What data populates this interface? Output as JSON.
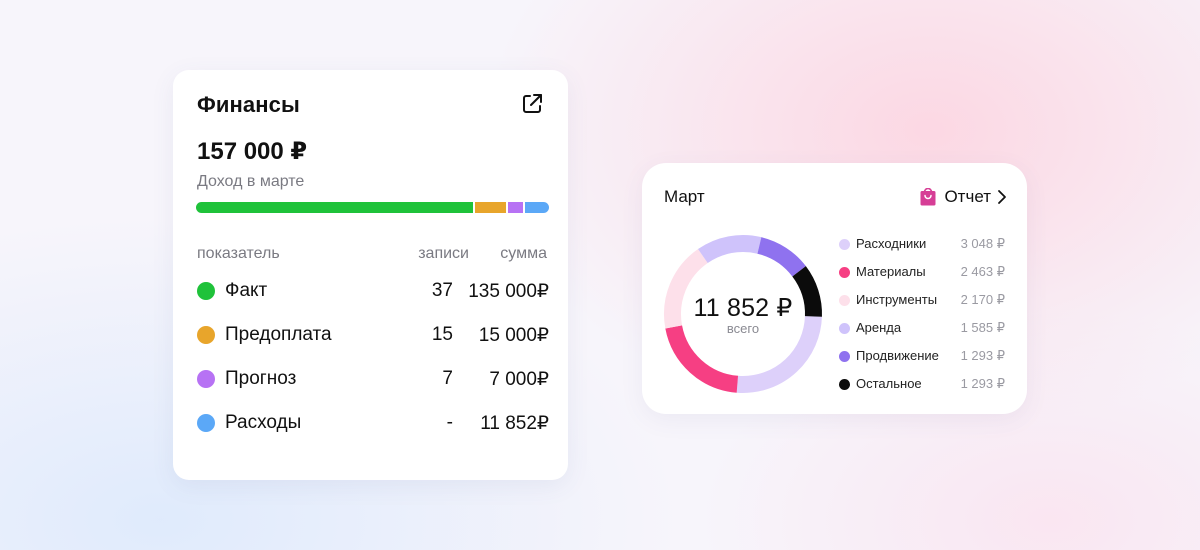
{
  "finance": {
    "title": "Финансы",
    "icons": {
      "external_link": "external-link-icon"
    },
    "amount": "157 000 ₽",
    "subtitle": "Доход в марте",
    "progress": [
      {
        "name": "Факт",
        "value": 135000,
        "color": "#1fc23a"
      },
      {
        "name": "Предоплата",
        "value": 15000,
        "color": "#e8a52b"
      },
      {
        "name": "Прогноз",
        "value": 7000,
        "color": "#b772f4"
      },
      {
        "name": "Расходы",
        "value": 11852,
        "color": "#5ba8f7"
      }
    ],
    "table": {
      "headers": {
        "name": "показатель",
        "records": "записи",
        "sum": "сумма"
      },
      "rows": [
        {
          "name": "Факт",
          "records": "37",
          "sum": "135 000₽",
          "color": "#1fc23a"
        },
        {
          "name": "Предоплата",
          "records": "15",
          "sum": "15 000₽",
          "color": "#e8a52b"
        },
        {
          "name": "Прогноз",
          "records": "7",
          "sum": "7 000₽",
          "color": "#b772f4"
        },
        {
          "name": "Расходы",
          "records": "-",
          "sum": "11 852₽",
          "color": "#5ba8f7"
        }
      ]
    }
  },
  "march": {
    "title": "Март",
    "report": {
      "label": "Отчет",
      "icon": "shopping-bag-icon",
      "chevron": "chevron-right-icon",
      "icon_color": "#d63e96"
    },
    "total": "11 852 ₽",
    "total_caption": "всего",
    "legend": [
      {
        "name": "Расходники",
        "value": "3 048 ₽",
        "color": "#ddd0fa"
      },
      {
        "name": "Материалы",
        "value": "2 463 ₽",
        "color": "#f63f83"
      },
      {
        "name": "Инструменты",
        "value": "2 170 ₽",
        "color": "#fde0ea"
      },
      {
        "name": "Аренда",
        "value": "1 585 ₽",
        "color": "#cfc3fb"
      },
      {
        "name": "Продвижение",
        "value": "1 293 ₽",
        "color": "#8f72ef"
      },
      {
        "name": "Остальное",
        "value": "1 293 ₽",
        "color": "#0b0b0b"
      }
    ]
  },
  "chart_data": {
    "type": "pie",
    "title": "Март",
    "categories": [
      "Расходники",
      "Материалы",
      "Инструменты",
      "Аренда",
      "Продвижение",
      "Остальное"
    ],
    "values": [
      3048,
      2463,
      2170,
      1585,
      1293,
      1293
    ],
    "colors": [
      "#ddd0fa",
      "#f63f83",
      "#fde0ea",
      "#cfc3fb",
      "#8f72ef",
      "#0b0b0b"
    ],
    "legend": "right"
  }
}
